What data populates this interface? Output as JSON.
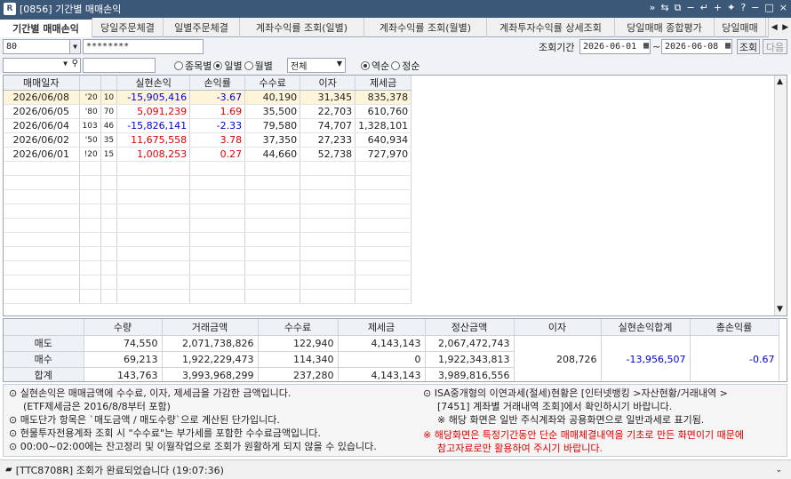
{
  "window": {
    "title": "[0856] 기간별 매매손익",
    "logo": "R"
  },
  "tabs": [
    {
      "label": "기간별 매매손익",
      "active": true
    },
    {
      "label": "당일주문체결"
    },
    {
      "label": "일별주문체결"
    },
    {
      "label": "계좌수익률 조회(일별)"
    },
    {
      "label": "계좌수익률 조회(월별)"
    },
    {
      "label": "계좌투자수익률 상세조회"
    },
    {
      "label": "당일매매 종합평가"
    },
    {
      "label": "당일매매"
    }
  ],
  "controls": {
    "account_value": "80",
    "password_value": "********",
    "period_label": "조회기간",
    "start_date": "2026-06-01",
    "tilde": "~",
    "end_date": "2026-06-08",
    "query_button": "조회",
    "next_button": "다음",
    "view_options": [
      "종목별",
      "일별",
      "월별"
    ],
    "view_selected": "일별",
    "filter_value": "전체",
    "sort_options": [
      "역순",
      "정순"
    ],
    "sort_selected": "역순"
  },
  "grid": {
    "columns": [
      "매매일자",
      "",
      "",
      "실현손익",
      "손익률",
      "수수료",
      "이자",
      "제세금"
    ],
    "rows": [
      {
        "date": "2026/06/08",
        "c1": "'20",
        "c2": "10",
        "pnl": "-15,905,416",
        "rate": "-3.67",
        "fee": "40,190",
        "interest": "31,345",
        "tax": "835,378",
        "sign": "neg"
      },
      {
        "date": "2026/06/05",
        "c1": "'80",
        "c2": "70",
        "pnl": "5,091,239",
        "rate": "1.69",
        "fee": "35,500",
        "interest": "22,703",
        "tax": "610,760",
        "sign": "pos"
      },
      {
        "date": "2026/06/04",
        "c1": "103",
        "c2": "46",
        "pnl": "-15,826,141",
        "rate": "-2.33",
        "fee": "79,580",
        "interest": "74,707",
        "tax": "1,328,101",
        "sign": "neg"
      },
      {
        "date": "2026/06/02",
        "c1": "'50",
        "c2": "35",
        "pnl": "11,675,558",
        "rate": "3.78",
        "fee": "37,350",
        "interest": "27,233",
        "tax": "640,934",
        "sign": "pos"
      },
      {
        "date": "2026/06/01",
        "c1": "!20",
        "c2": "15",
        "pnl": "1,008,253",
        "rate": "0.27",
        "fee": "44,660",
        "interest": "52,738",
        "tax": "727,970",
        "sign": "pos"
      }
    ]
  },
  "summary": {
    "headers": [
      "수량",
      "거래금액",
      "수수료",
      "제세금",
      "정산금액",
      "이자",
      "실현손익합계",
      "총손익률"
    ],
    "rows": [
      {
        "label": "매도",
        "qty": "74,550",
        "amount": "2,071,738,826",
        "fee": "122,940",
        "tax": "4,143,143",
        "settle": "2,067,472,743"
      },
      {
        "label": "매수",
        "qty": "69,213",
        "amount": "1,922,229,473",
        "fee": "114,340",
        "tax": "0",
        "settle": "1,922,343,813"
      },
      {
        "label": "합계",
        "qty": "143,763",
        "amount": "3,993,968,299",
        "fee": "237,280",
        "tax": "4,143,143",
        "settle": "3,989,816,556"
      }
    ],
    "interest": "208,726",
    "realized_total": "-13,956,507",
    "total_rate": "-0.67"
  },
  "notes": {
    "left": [
      "⊙ 실현손익은 매매금액에 수수료, 이자, 제세금을 가감한 금액입니다.",
      "(ETF제세금은 2016/8/8부터 포함)",
      "⊙ 매도단가 항목은 `매도금액 / 매도수량`으로 계산된 단가입니다.",
      "⊙ 현물투자전용계좌 조회 시 \"수수료\"는 부가세를 포함한 수수료금액입니다.",
      "⊙ 00:00~02:00에는 잔고정리 및 이월작업으로 조회가 원활하게 되지 않을 수 있습니다."
    ],
    "right": [
      "⊙ ISA중개형의 이연과세(절세)현황은 [인터넷뱅킹 >자산현황/거래내역 >",
      "[7451] 계좌별 거래내역 조회]에서 확인하시기 바랍니다.",
      "※ 해당 화면은 일반 주식계좌와 공용화면으로 일반과세로 표기됨.",
      "※ 해당화면은 특정기간동안 단순 매매체결내역을 기초로 만든 화면이기 때문에",
      "참고자료로만 활용하여 주시기 바랍니다."
    ]
  },
  "status": {
    "message": "[TTC8708R] 조회가 완료되었습니다 (19:07:36)"
  },
  "colors": {
    "title_bg": "#3c5879",
    "negative": "#0000d8",
    "positive": "#e00000",
    "warning": "#e00000"
  }
}
